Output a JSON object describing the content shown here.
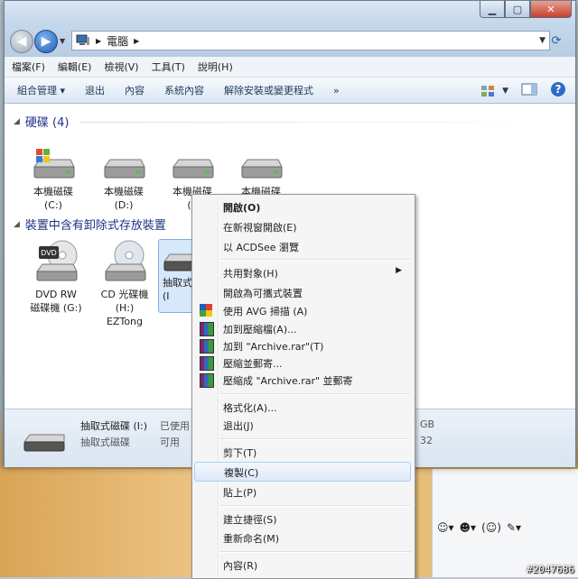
{
  "window": {
    "address_path": "電腦",
    "menu": [
      "檔案(F)",
      "編輯(E)",
      "檢視(V)",
      "工具(T)",
      "說明(H)"
    ],
    "commands": [
      "組合管理",
      "退出",
      "內容",
      "系統內容",
      "解除安裝或變更程式"
    ],
    "more_commands": "»"
  },
  "groups": {
    "hard_disks": {
      "title": "硬碟 (4)",
      "drives": [
        {
          "line1": "本機磁碟",
          "line2": "(C:)"
        },
        {
          "line1": "本機磁碟",
          "line2": "(D:)"
        },
        {
          "line1": "本機磁碟",
          "line2": "(E"
        },
        {
          "line1": "本機磁碟",
          "line2": ""
        }
      ]
    },
    "removable": {
      "title": "裝置中含有卸除式存放裝置",
      "drives": [
        {
          "line1": "DVD RW",
          "line2": "磁碟機 (G:)",
          "line3": "",
          "badge": "DVD"
        },
        {
          "line1": "CD 光碟機",
          "line2": "(H:)",
          "line3": "EZTong"
        },
        {
          "line1": "抽取式",
          "line2": "(I",
          "line3": ""
        }
      ]
    }
  },
  "details": {
    "name": "抽取式磁碟 (I:)",
    "type": "抽取式磁碟",
    "used_label": "已使用",
    "free_label": "可用",
    "size_tail": "GB",
    "free_tail": "32"
  },
  "context_menu": {
    "items": [
      {
        "label": "開啟(O)",
        "bold": true
      },
      {
        "label": "在新視窗開啟(E)"
      },
      {
        "label": "以 ACDSee 瀏覽"
      },
      {
        "label": "共用對象(H)",
        "submenu": "▶"
      },
      {
        "label": "開啟為可攜式裝置"
      },
      {
        "label": "使用 AVG 掃描 (A)"
      },
      {
        "label": "加到壓縮檔(A)..."
      },
      {
        "label": "加到 \"Archive.rar\"(T)"
      },
      {
        "label": "壓縮並郵寄..."
      },
      {
        "label": "壓縮成 \"Archive.rar\" 並郵寄"
      },
      {
        "label": "格式化(A)..."
      },
      {
        "label": "退出(J)"
      },
      {
        "label": "剪下(T)"
      },
      {
        "label": "複製(C)"
      },
      {
        "label": "貼上(P)"
      },
      {
        "label": "建立捷徑(S)"
      },
      {
        "label": "重新命名(M)"
      },
      {
        "label": "內容(R)"
      }
    ]
  },
  "watermark": "#2047686",
  "colors": {
    "group_title": "#1e3287",
    "highlight": "#dde9f8"
  }
}
